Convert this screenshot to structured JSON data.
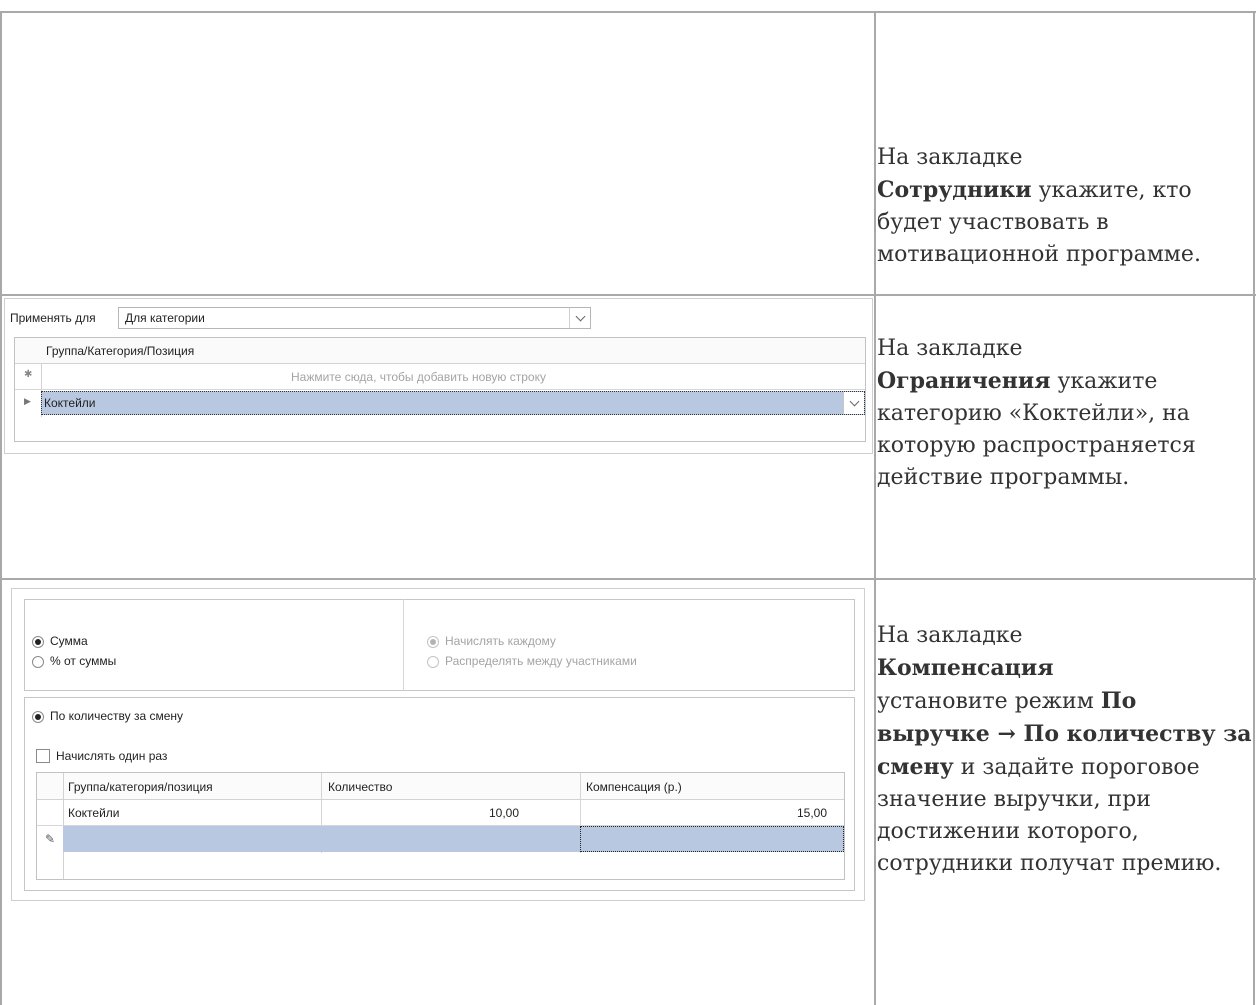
{
  "descriptions": {
    "employees": {
      "pre": "На закладке",
      "bold": "Сотрудники",
      "post": "укажите, кто будет участвовать в мотивационной программе."
    },
    "restrictions": {
      "pre": "На закладке",
      "bold": "Ограничения",
      "post": "укажите категорию «Коктейли», на которую распространяется действие программы."
    },
    "compensation": {
      "pre": "На закладке",
      "bold": "Компенсация",
      "mid": "установите режим",
      "bold2": "По выручке → По количеству за смену",
      "post": "и задайте пороговое значение выручки, при достижении которого, сотрудники получат премию."
    }
  },
  "restrictions_ui": {
    "apply_label": "Применять для",
    "apply_value": "Для категории",
    "grid_header": "Группа/Категория/Позиция",
    "new_row_marker": "✱",
    "new_row_hint": "Нажмите сюда, чтобы добавить новую строку",
    "row_value": "Коктейли"
  },
  "compensation_ui": {
    "radio_sum": "Сумма",
    "radio_percent": "% от суммы",
    "radio_each": "Начислять каждому",
    "radio_distribute": "Распределять между участниками",
    "radio_per_shift": "По количеству за смену",
    "checkbox_once": "Начислять один раз",
    "table": {
      "headers": [
        "Группа/категория/позиция",
        "Количество",
        "Компенсация (р.)"
      ],
      "row": [
        "Коктейли",
        "10,00",
        "15,00"
      ]
    }
  }
}
